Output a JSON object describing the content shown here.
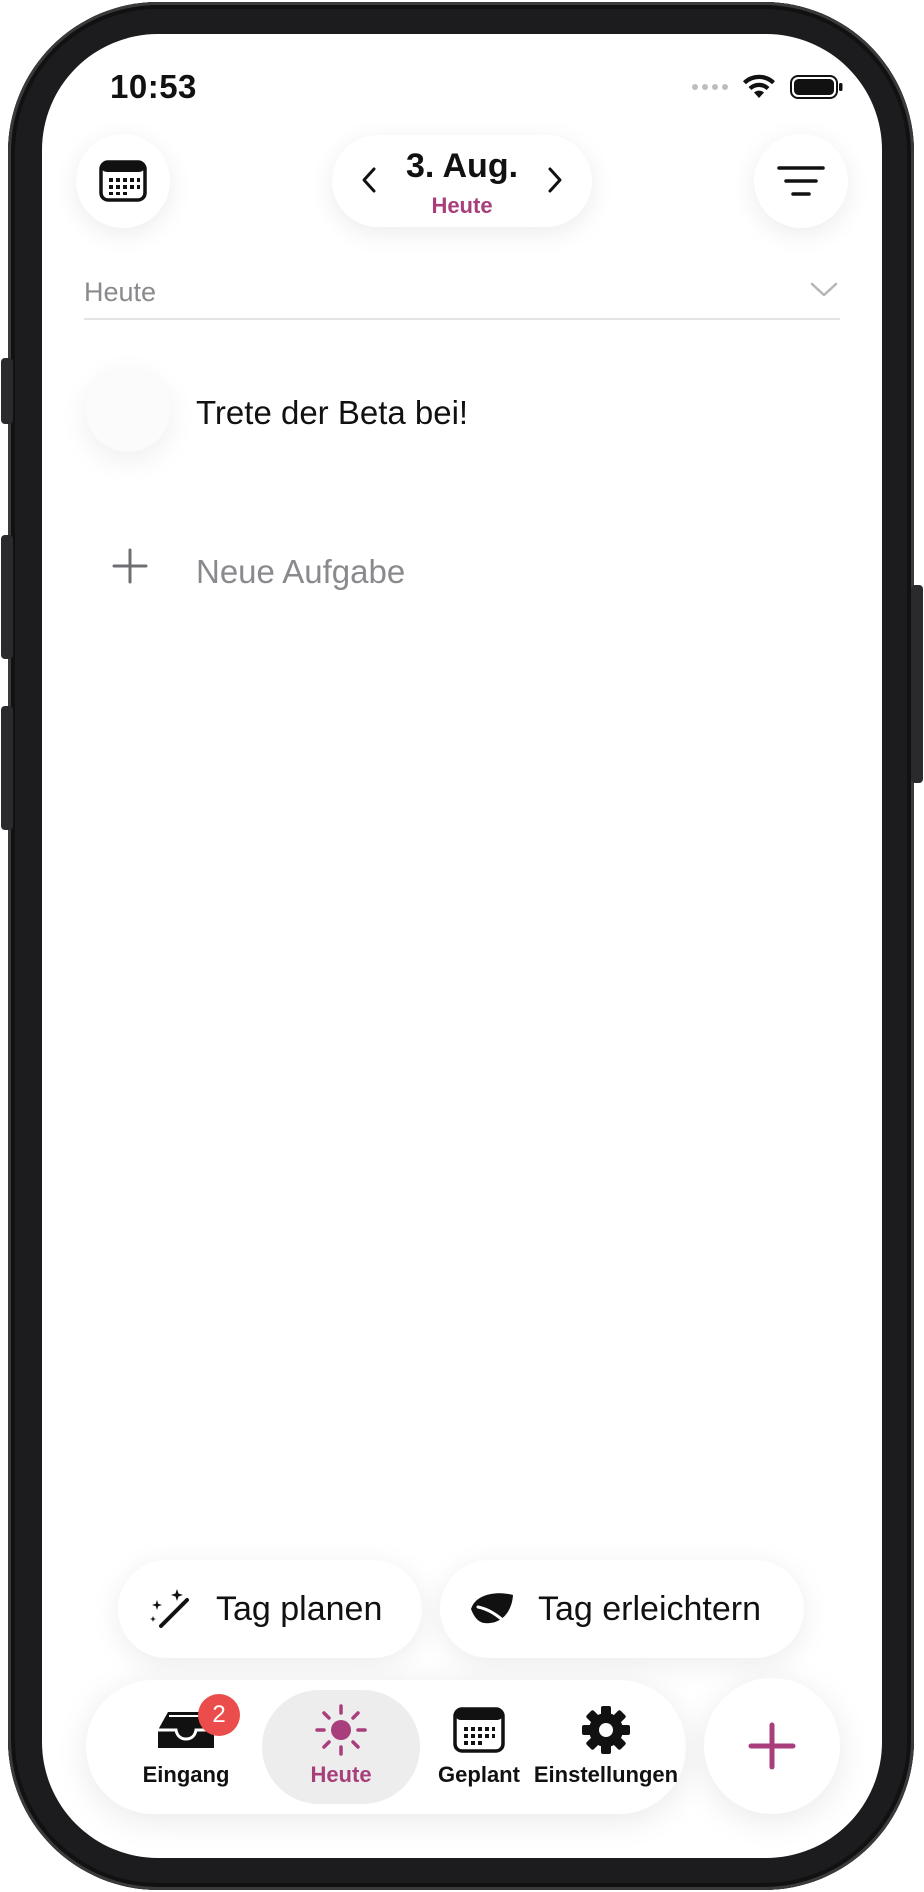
{
  "status_bar": {
    "time": "10:53"
  },
  "header": {
    "date": "3. Aug.",
    "date_sub": "Heute"
  },
  "section": {
    "title": "Heute"
  },
  "tasks": [
    {
      "label": "Trete der Beta bei!"
    }
  ],
  "new_task": {
    "label": "Neue Aufgabe"
  },
  "actions": {
    "plan_label": "Tag planen",
    "ease_label": "Tag erleichtern"
  },
  "tabbar": {
    "inbox_label": "Eingang",
    "inbox_badge": "2",
    "today_label": "Heute",
    "planned_label": "Geplant",
    "settings_label": "Einstellungen"
  },
  "colors": {
    "accent": "#a83f7c",
    "badge": "#ea4d4b",
    "text_primary": "#111111",
    "text_secondary": "#8a8a8e"
  },
  "icons": {
    "calendar": "calendar-icon",
    "filter": "filter-lines-icon",
    "prev": "chevron-left-icon",
    "next": "chevron-right-icon",
    "section_toggle": "chevron-down-icon",
    "add": "plus-icon",
    "plan": "magic-wand-icon",
    "ease": "leaf-icon",
    "inbox": "inbox-tray-icon",
    "today": "sun-icon",
    "planned": "calendar-icon",
    "settings": "gear-icon"
  }
}
